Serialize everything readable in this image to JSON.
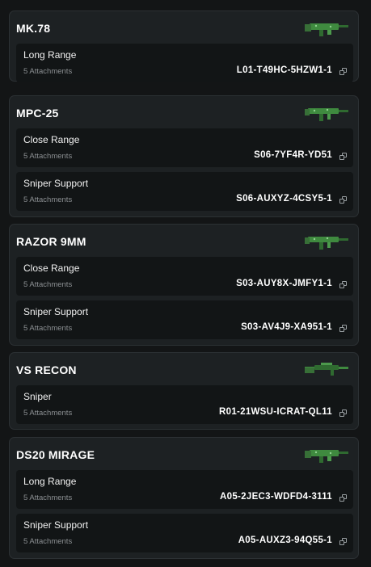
{
  "colors": {
    "background": "#131516",
    "card": "#1d2123",
    "card_border": "#2c3134",
    "build_row": "#121516",
    "muted_text": "#8b8f92",
    "camo_green": "#3f8a3f"
  },
  "weapons": [
    {
      "name": "MK.78",
      "image_icon": "assault-rifle-camo-icon",
      "builds": [
        {
          "name": "Long Range",
          "attachments": "5 Attachments",
          "code": "L01-T49HC-5HZW1-1"
        }
      ]
    },
    {
      "name": "MPC-25",
      "image_icon": "smg-camo-icon",
      "builds": [
        {
          "name": "Close Range",
          "attachments": "5 Attachments",
          "code": "S06-7YF4R-YD51"
        },
        {
          "name": "Sniper Support",
          "attachments": "5 Attachments",
          "code": "S06-AUXYZ-4CSY5-1"
        }
      ]
    },
    {
      "name": "RAZOR 9MM",
      "image_icon": "smg-camo-icon",
      "builds": [
        {
          "name": "Close Range",
          "attachments": "5 Attachments",
          "code": "S03-AUY8X-JMFY1-1"
        },
        {
          "name": "Sniper Support",
          "attachments": "5 Attachments",
          "code": "S03-AV4J9-XA951-1"
        }
      ]
    },
    {
      "name": "VS RECON",
      "image_icon": "sniper-rifle-camo-icon",
      "builds": [
        {
          "name": "Sniper",
          "attachments": "5 Attachments",
          "code": "R01-21WSU-ICRAT-QL11"
        }
      ]
    },
    {
      "name": "DS20 MIRAGE",
      "image_icon": "assault-rifle-camo-icon",
      "builds": [
        {
          "name": "Long Range",
          "attachments": "5 Attachments",
          "code": "A05-2JEC3-WDFD4-3111"
        },
        {
          "name": "Sniper Support",
          "attachments": "5 Attachments",
          "code": "A05-AUXZ3-94Q55-1"
        }
      ]
    }
  ]
}
